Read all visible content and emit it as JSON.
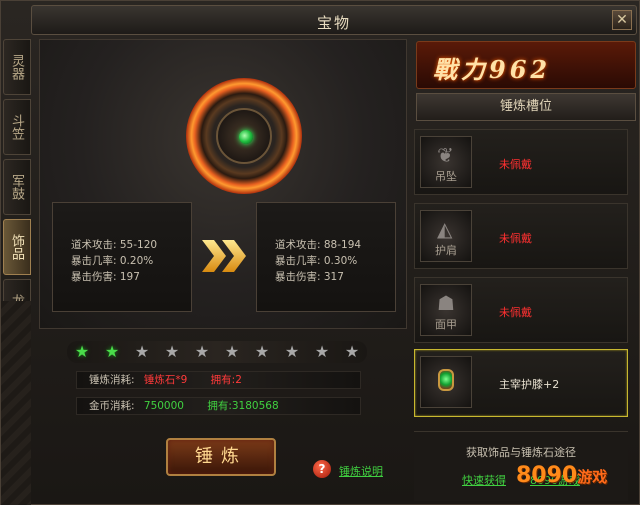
{
  "window": {
    "title": "宝物",
    "close_label": "✕"
  },
  "side_tabs": [
    {
      "label": "灵器",
      "active": false
    },
    {
      "label": "斗笠",
      "active": false
    },
    {
      "label": "军鼓",
      "active": false
    },
    {
      "label": "饰品",
      "active": true
    },
    {
      "label": "龙灵",
      "active": false
    }
  ],
  "stats_current": [
    "道术攻击: 55-120",
    "暴击几率: 0.20%",
    "暴击伤害: 197"
  ],
  "stats_next": [
    "道术攻击: 88-194",
    "暴击几率: 0.30%",
    "暴击伤害: 317"
  ],
  "stars": {
    "filled": 2,
    "total": 10,
    "on_color": "#4adc4a",
    "off_color": "#a8a8a8"
  },
  "cost_stone": {
    "label": "锤炼消耗:",
    "item": "锤炼石*9",
    "owned_label": "拥有:",
    "owned": "2"
  },
  "cost_gold": {
    "label": "金币消耗:",
    "amount": "750000",
    "owned_label": "拥有:",
    "owned": "3180568"
  },
  "refine_button": "锤炼",
  "help": {
    "icon": "?",
    "link": "锤炼说明"
  },
  "power": {
    "text": "戰力962"
  },
  "slots_title": "锤炼槽位",
  "slots": [
    {
      "name": "吊坠",
      "glyph": "pendant-icon",
      "status": "未佩戴",
      "equipped": false
    },
    {
      "name": "护肩",
      "glyph": "shoulder-icon",
      "status": "未佩戴",
      "equipped": false
    },
    {
      "name": "面甲",
      "glyph": "mask-icon",
      "status": "未佩戴",
      "equipped": false
    },
    {
      "name": "",
      "glyph": "knee-guard-icon",
      "status": "主宰护膝+2",
      "equipped": true
    }
  ],
  "obtain": {
    "title": "获取饰品与锤炼石途径",
    "quick": "快速获得",
    "quick2": "8090游戏"
  },
  "watermark": {
    "main": "8090",
    "sub": "游戏"
  }
}
